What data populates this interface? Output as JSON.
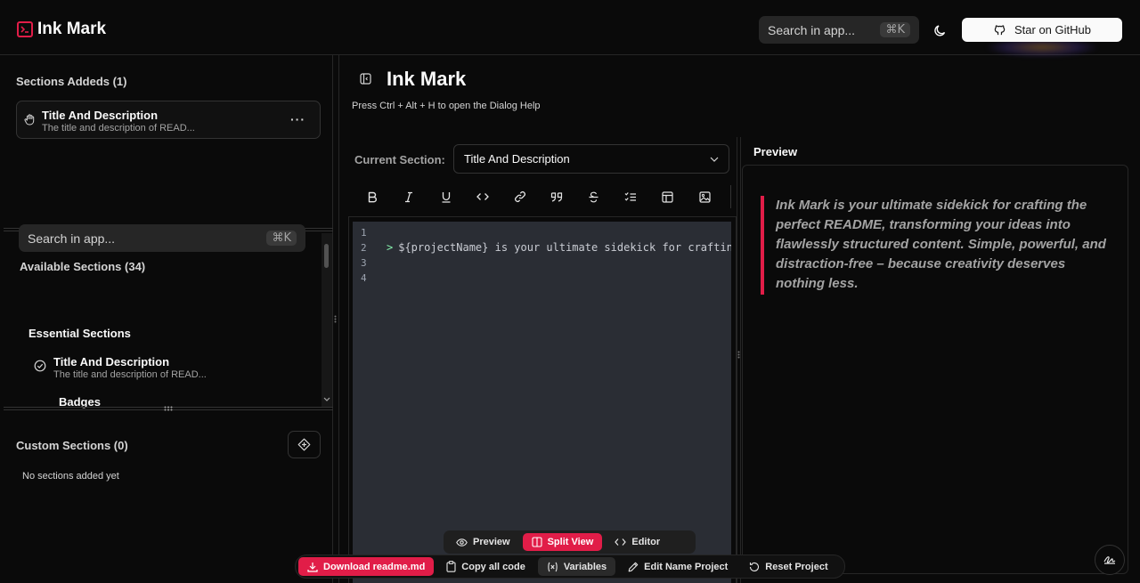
{
  "app": {
    "name": "Ink Mark"
  },
  "header": {
    "search_placeholder": "Search in app...",
    "search_shortcut": "⌘K",
    "github_label": "Star on GitHub"
  },
  "sidebar": {
    "added_title": "Sections Addeds (1)",
    "added_items": [
      {
        "title": "Title And Description",
        "desc": "The title and description of READ..."
      }
    ],
    "available_title": "Available Sections (34)",
    "search_placeholder": "Search in app...",
    "search_shortcut": "⌘K",
    "group_title": "Essential Sections",
    "available_items": [
      {
        "title": "Title And Description",
        "desc": "The title and description of READ..."
      },
      {
        "title": "Badges"
      }
    ],
    "custom_title": "Custom Sections (0)",
    "custom_empty": "No sections added yet"
  },
  "main": {
    "title": "Ink Mark",
    "help": "Press Ctrl + Alt + H to open the Dialog Help",
    "current_label": "Current Section:",
    "current_value": "Title And Description",
    "toolbar": [
      "bold",
      "italic",
      "underline",
      "code",
      "link",
      "quote",
      "strikethrough",
      "task-list",
      "table",
      "image"
    ],
    "editor": {
      "lines": [
        "1",
        "2",
        "3",
        "4"
      ],
      "code_prefix": ">",
      "code": "${projectName} is your ultimate sidekick for crafting th"
    }
  },
  "preview": {
    "title": "Preview",
    "quote": "Ink Mark is your ultimate sidekick for crafting the perfect README, transforming your ideas into flawlessly structured content. Simple, powerful, and distraction-free – because creativity deserves nothing less."
  },
  "viewbar": {
    "preview": "Preview",
    "split": "Split View",
    "editor": "Editor",
    "active": "split"
  },
  "actions": {
    "download": "Download readme.md",
    "copy": "Copy all code",
    "variables": "Variables",
    "edit_name": "Edit Name Project",
    "reset": "Reset Project"
  },
  "colors": {
    "accent": "#e11d48",
    "bg": "#0a0a0a",
    "editor_bg": "#2a2d34"
  }
}
